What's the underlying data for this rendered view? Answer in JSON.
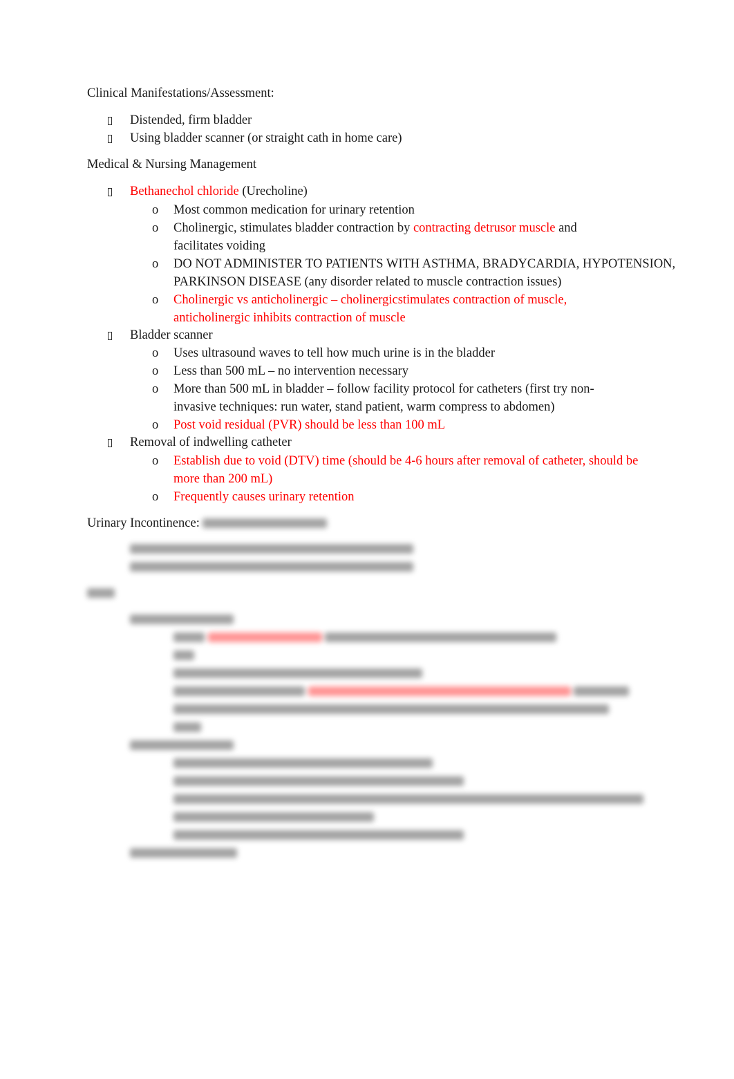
{
  "sections": {
    "clinical": {
      "heading": "Clinical Manifestations/Assessment:",
      "items": [
        "Distended, firm bladder",
        "Using bladder scanner (or straight cath in home care)"
      ]
    },
    "management": {
      "heading": "Medical & Nursing Management",
      "bethanechol": {
        "red_label": "Bethanechol chloride",
        "black_label": " (Urecholine)",
        "sub": {
          "s1": "Most common medication for urinary retention",
          "s2_a": "Cholinergic, stimulates bladder contraction by ",
          "s2_red": "contracting detrusor muscle",
          "s2_b": "  and facilitates voiding",
          "s3": "DO NOT ADMINISTER TO PATIENTS WITH ASTHMA, BRADYCARDIA, HYPOTENSION, PARKINSON DISEASE (any disorder related to muscle contraction issues)",
          "s4": "Cholinergic vs anticholinergic – cholinergicstimulates  contraction of muscle, anticholinergic inhibits contraction of muscle"
        }
      },
      "scanner": {
        "label": "Bladder scanner",
        "sub": {
          "s1": "Uses ultrasound waves to tell how much urine is in the bladder",
          "s2": "Less than 500 mL – no intervention necessary",
          "s3": "More than 500 mL in bladder – follow facility protocol for catheters (first try non-invasive techniques: run water, stand patient, warm compress to abdomen)",
          "s4": "Post void residual (PVR) should be less than 100 mL"
        }
      },
      "catheter": {
        "label": "Removal of indwelling catheter",
        "sub": {
          "s1": "Establish due to void (DTV) time (should be 4-6 hours after removal of catheter, should be more than 200 mL)",
          "s2": "Frequently causes urinary retention"
        }
      }
    },
    "incontinence": {
      "heading": "Urinary Incontinence:"
    }
  },
  "bullet_marker": "o",
  "colors": {
    "highlight": "#ff0000",
    "text": "#1a1a1a"
  }
}
